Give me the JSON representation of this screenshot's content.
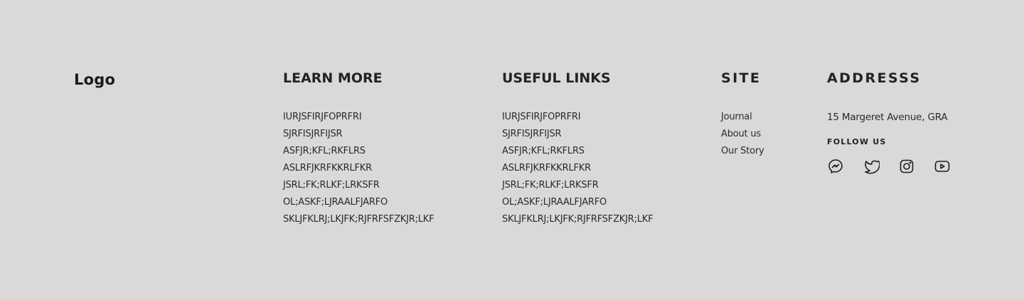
{
  "logo": {
    "text": "Logo"
  },
  "learn_more": {
    "title": "LEARN MORE",
    "items": [
      "IURJSFIRJFOPRFRI",
      "SJRFISJRFIJSR",
      "ASFJR;KFL;RKFLRS",
      "ASLRFJKRFKKRLFKR",
      "JSRL;FK;RLKF;LRKSFR",
      "OL;ASKF;LJRAALFJARFO",
      "SKLJFKLRJ;LKJFK;RJFRFSFZKJR;LKF"
    ]
  },
  "useful_links": {
    "title": "USEFUL LINKS",
    "items": [
      "IURJSFIRJFOPRFRI",
      "SJRFISJRFIJSR",
      "ASFJR;KFL;RKFLRS",
      "ASLRFJKRFKKRLFKR",
      "JSRL;FK;RLKF;LRKSFR",
      "OL;ASKF;LJRAALFJARFO",
      "SKLJFKLRJ;LKJFK;RJFRFSFZKJR;LKF"
    ]
  },
  "site": {
    "title": "SITE",
    "items": [
      "Journal",
      "About us",
      "Our Story"
    ]
  },
  "address": {
    "title": "ADDRESSS",
    "text": "15 Margeret Avenue, GRA",
    "follow_label": "FOLLOW US",
    "socials": [
      {
        "icon": "messenger-icon"
      },
      {
        "icon": "twitter-icon"
      },
      {
        "icon": "instagram-icon"
      },
      {
        "icon": "youtube-icon"
      }
    ]
  }
}
